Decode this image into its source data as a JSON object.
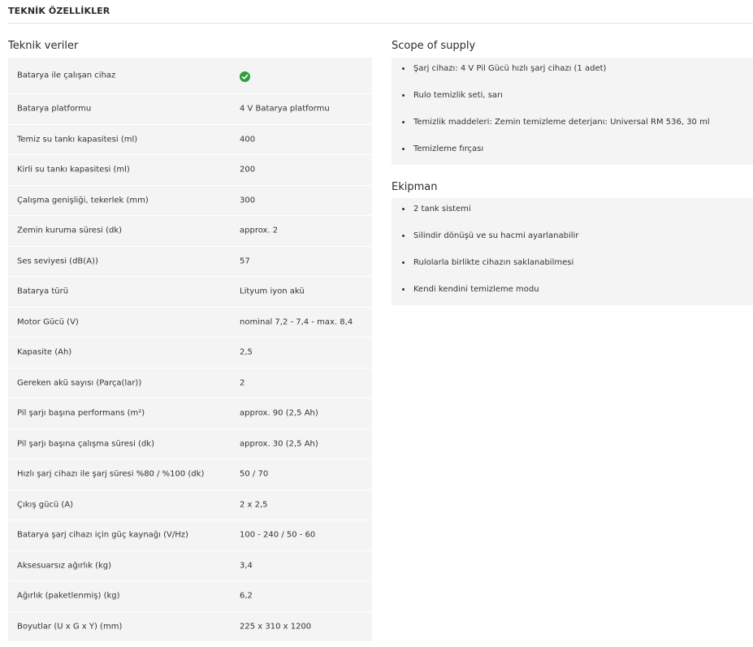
{
  "header": {
    "title": "TEKNİK ÖZELLİKLER"
  },
  "tech": {
    "title": "Teknik veriler",
    "rows": [
      {
        "label": "Batarya ile çalışan cihaz",
        "value": "",
        "icon": "check-circle-icon",
        "icon_color": "#2e9e3f"
      },
      {
        "label": "Batarya platformu",
        "value": "4 V Batarya platformu"
      },
      {
        "label": "Temiz su tankı kapasitesi (ml)",
        "value": "400"
      },
      {
        "label": "Kirli su tankı kapasitesi (ml)",
        "value": "200"
      },
      {
        "label": "Çalışma genişliği, tekerlek (mm)",
        "value": "300"
      },
      {
        "label": "Zemin kuruma süresi (dk)",
        "value": "approx. 2"
      },
      {
        "label": "Ses seviyesi (dB(A))",
        "value": "57"
      },
      {
        "label": "Batarya türü",
        "value": "Lityum iyon akü"
      },
      {
        "label": "Motor Gücü (V)",
        "value": "nominal 7,2 - 7,4 - max. 8,4"
      },
      {
        "label": "Kapasite (Ah)",
        "value": "2,5"
      },
      {
        "label": "Gereken akü sayısı (Parça(lar))",
        "value": "2"
      },
      {
        "label": "Pil şarjı başına performans (m²)",
        "value": "approx. 90 (2,5 Ah)"
      },
      {
        "label": "Pil şarjı başına çalışma süresi (dk)",
        "value": "approx. 30 (2,5 Ah)"
      },
      {
        "label": "Hızlı şarj cihazı ile şarj süresi %80 / %100 (dk)",
        "value": "50 / 70"
      },
      {
        "label": "Çıkış gücü (A)",
        "value": "2 x 2,5"
      },
      {
        "label": "Batarya şarj cihazı için güç kaynağı (V/Hz)",
        "value": "100 - 240 / 50 - 60"
      },
      {
        "label": "Aksesuarsız ağırlık (kg)",
        "value": "3,4"
      },
      {
        "label": "Ağırlık (paketlenmiş) (kg)",
        "value": "6,2"
      },
      {
        "label": "Boyutlar (U x G x Y) (mm)",
        "value": "225 x 310 x 1200"
      }
    ]
  },
  "supply": {
    "title": "Scope of supply",
    "items": [
      "Şarj cihazı: 4 V Pil Gücü hızlı şarj cihazı (1 adet)",
      "Rulo temizlik seti, sarı",
      "Temizlik maddeleri: Zemin temizleme deterjanı: Universal RM 536, 30 ml",
      "Temizleme fırçası"
    ]
  },
  "equipment": {
    "title": "Ekipman",
    "items": [
      "2 tank sistemi",
      "Silindir dönüşü ve su hacmi ayarlanabilir",
      "Rulolarla birlikte cihazın saklanabilmesi",
      "Kendi kendini temizleme modu"
    ]
  }
}
